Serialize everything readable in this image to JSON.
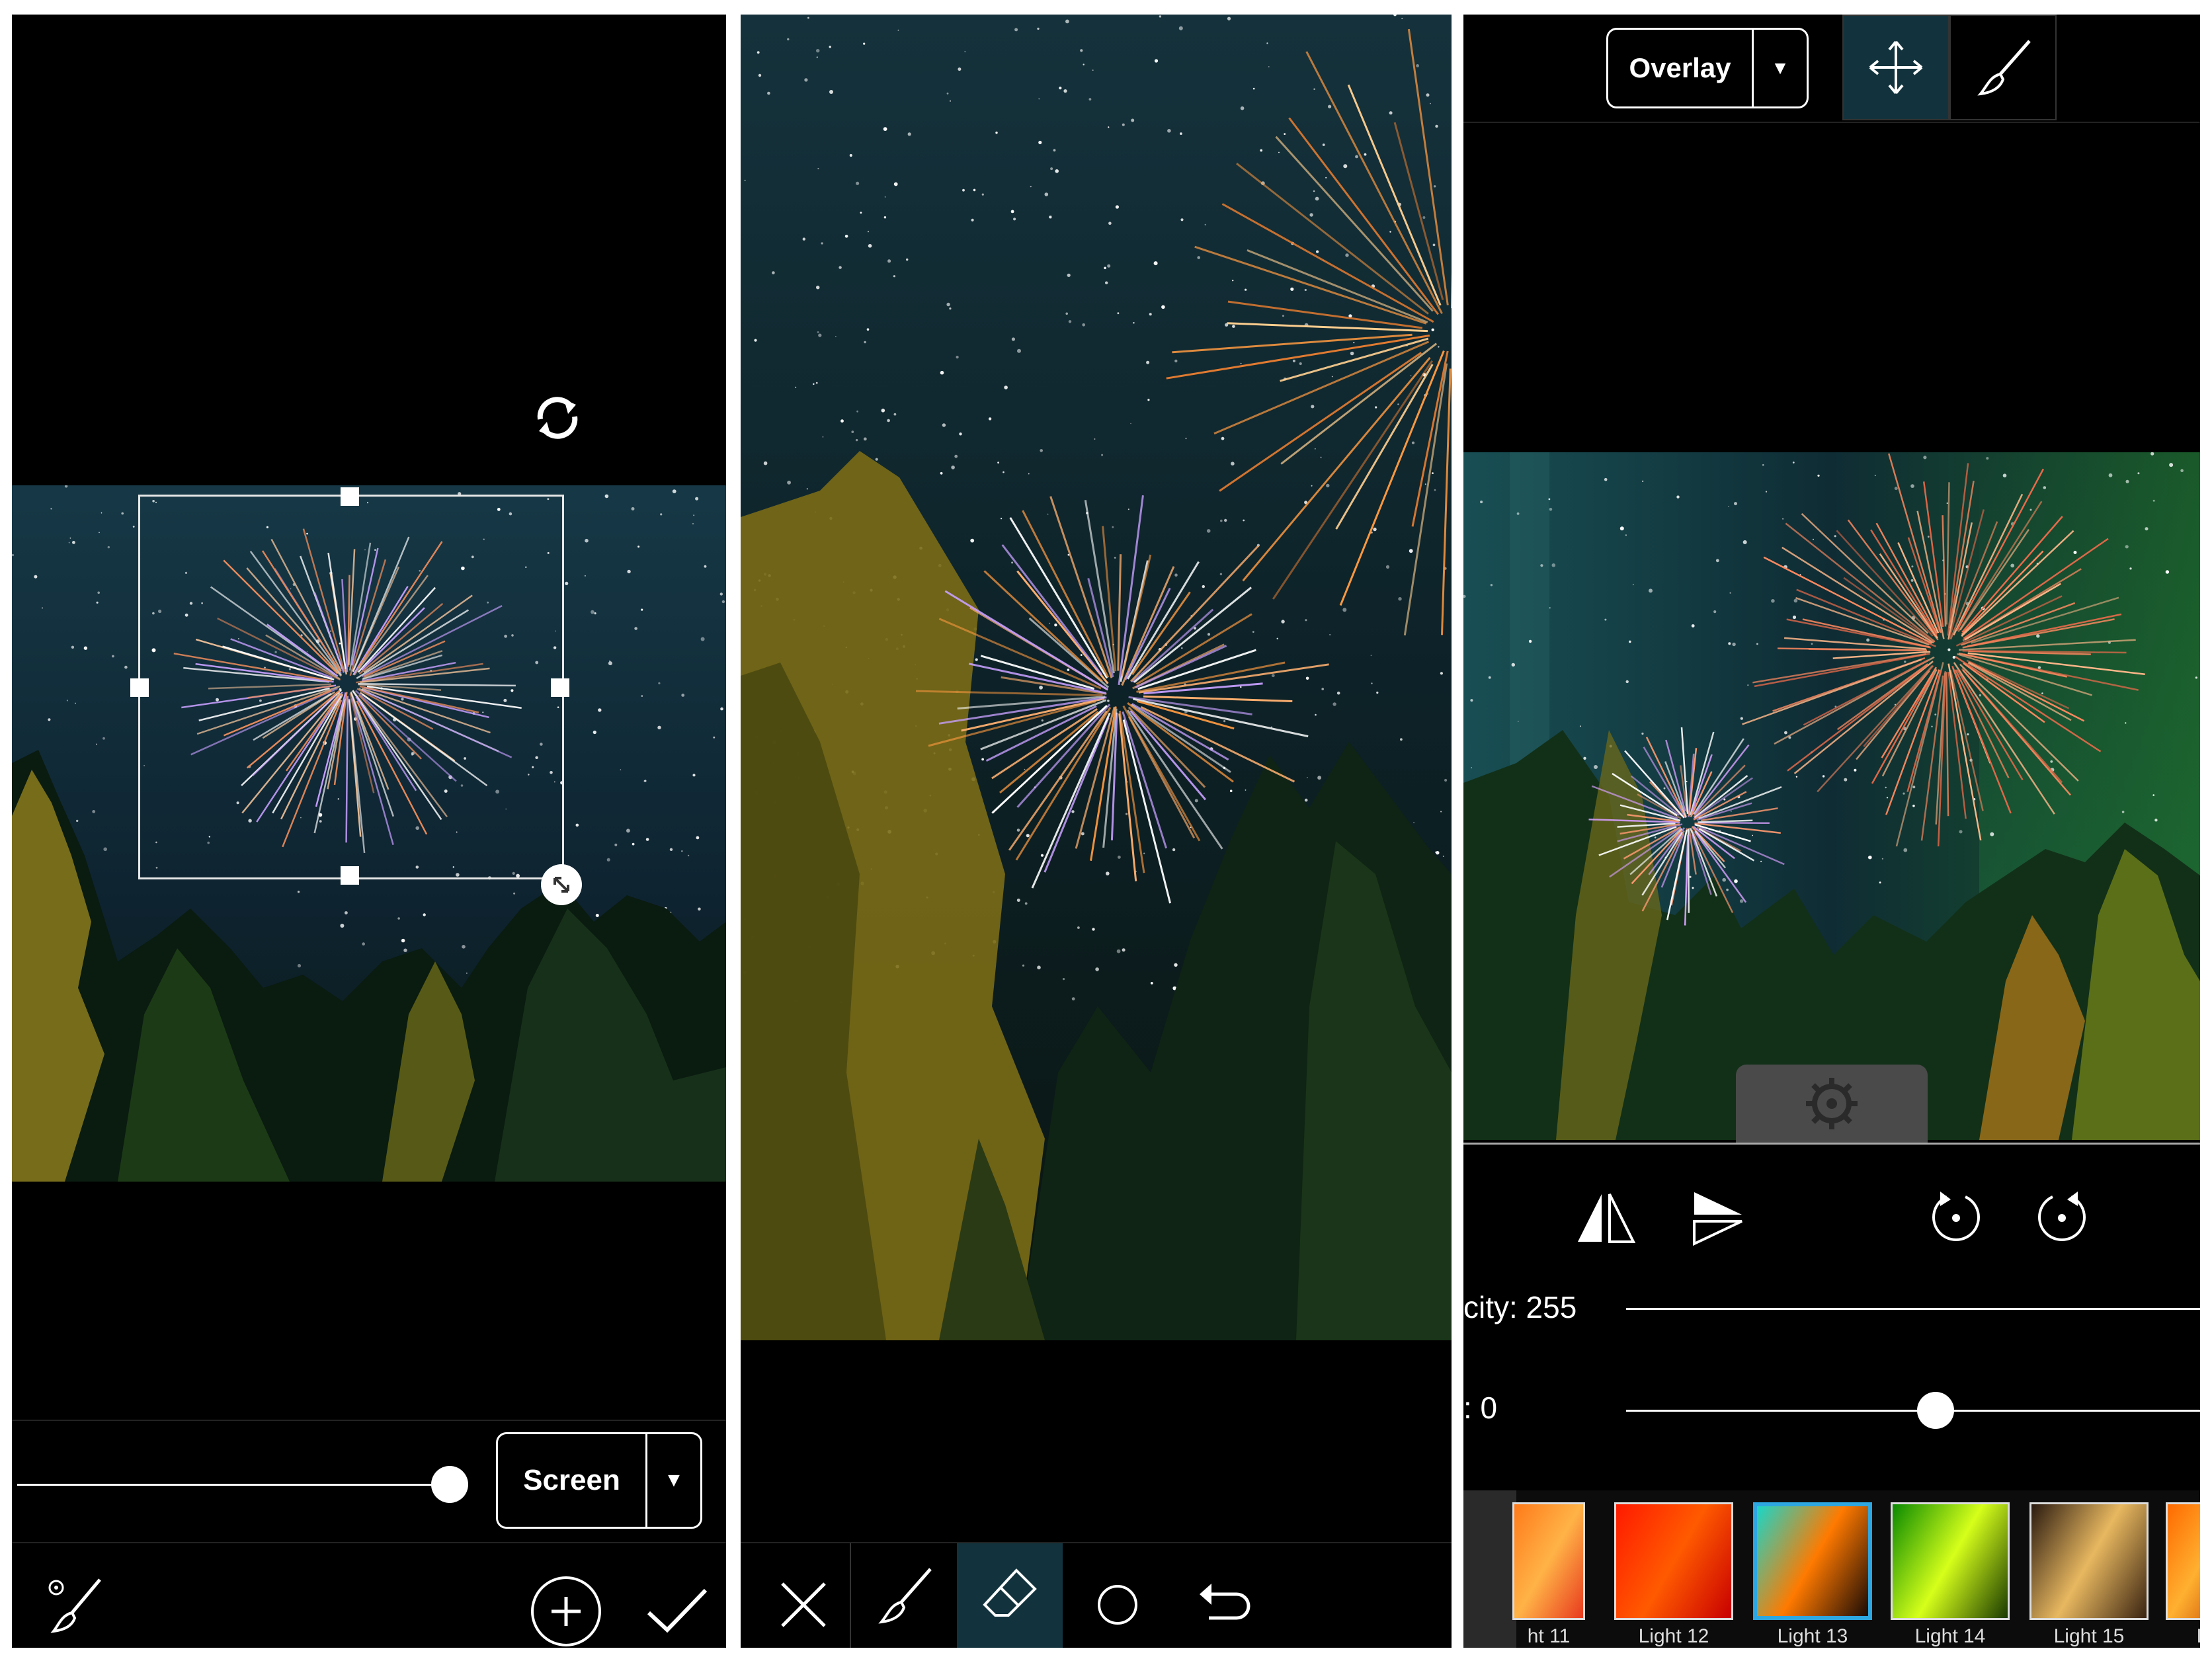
{
  "panel1": {
    "blend_mode": "Screen",
    "dropdown_arrow": "▼",
    "icons": [
      "rotate-icon",
      "resize-icon",
      "brush-settings-icon",
      "add-icon",
      "checkmark-icon"
    ]
  },
  "panel2": {
    "tools": [
      "close-icon",
      "brush-icon",
      "eraser-icon",
      "circle-icon",
      "undo-icon"
    ],
    "active_tool": "eraser-icon"
  },
  "panel3": {
    "blend_mode": "Overlay",
    "dropdown_arrow": "▼",
    "opacity_label": "city: 255",
    "second_label": ": 0",
    "opacity_value": 255,
    "second_slider_fraction": 0.5,
    "thumbnails": [
      {
        "label": "ht 11",
        "colors": [
          "#ff7a1a",
          "#ffb347",
          "#e83a1e"
        ]
      },
      {
        "label": "Light 12",
        "colors": [
          "#ff1a00",
          "#ff5a00",
          "#c80000"
        ]
      },
      {
        "label": "Light 13",
        "colors": [
          "#1ad6c8",
          "#ff7a00",
          "#1a0b05"
        ],
        "selected": true
      },
      {
        "label": "Light 14",
        "colors": [
          "#0a8a00",
          "#d6ff1a",
          "#1a3a00"
        ]
      },
      {
        "label": "Light 15",
        "colors": [
          "#2a1a10",
          "#e8b860",
          "#3a2412"
        ]
      },
      {
        "label": "L",
        "colors": [
          "#ff6a00",
          "#ffb030",
          "#c04000"
        ]
      }
    ],
    "accent": "#2ea6e0"
  }
}
